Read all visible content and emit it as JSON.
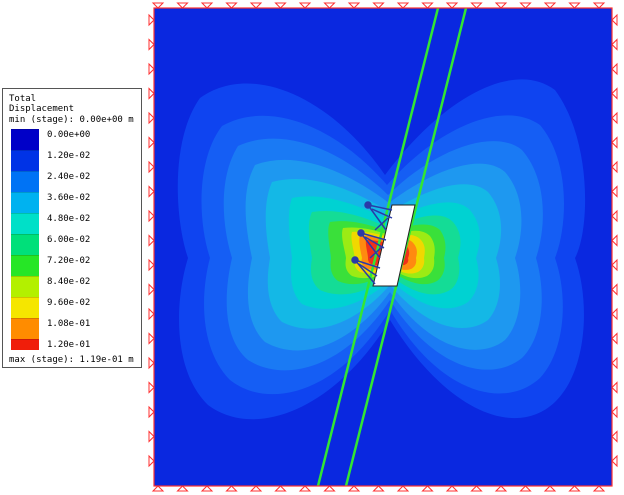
{
  "legend": {
    "title_line1": "Total",
    "title_line2": "Displacement",
    "min_label": "min (stage): 0.00e+00 m",
    "max_label": "max (stage): 1.19e-01 m",
    "ticks": [
      {
        "label": "0.00e+00",
        "color": "#0000c8"
      },
      {
        "label": "1.20e-02",
        "color": "#0033e6"
      },
      {
        "label": "2.40e-02",
        "color": "#0073f5"
      },
      {
        "label": "3.60e-02",
        "color": "#00b2f0"
      },
      {
        "label": "4.80e-02",
        "color": "#00e0c8"
      },
      {
        "label": "6.00e-02",
        "color": "#00e07a"
      },
      {
        "label": "7.20e-02",
        "color": "#26e626"
      },
      {
        "label": "8.40e-02",
        "color": "#b3f000"
      },
      {
        "label": "9.60e-02",
        "color": "#f5e600"
      },
      {
        "label": "1.08e-01",
        "color": "#ff8c00"
      },
      {
        "label": "1.20e-01",
        "color": "#f01e0a"
      }
    ]
  },
  "colors": {
    "background_field": "#0a28e0",
    "boundary_marker": "#ff3030",
    "fault_line": "#33e633",
    "excavation": "#ffffff",
    "support": "#2a3aa8"
  },
  "icons": {
    "boundary_support": "triangle-fixity-icon"
  }
}
